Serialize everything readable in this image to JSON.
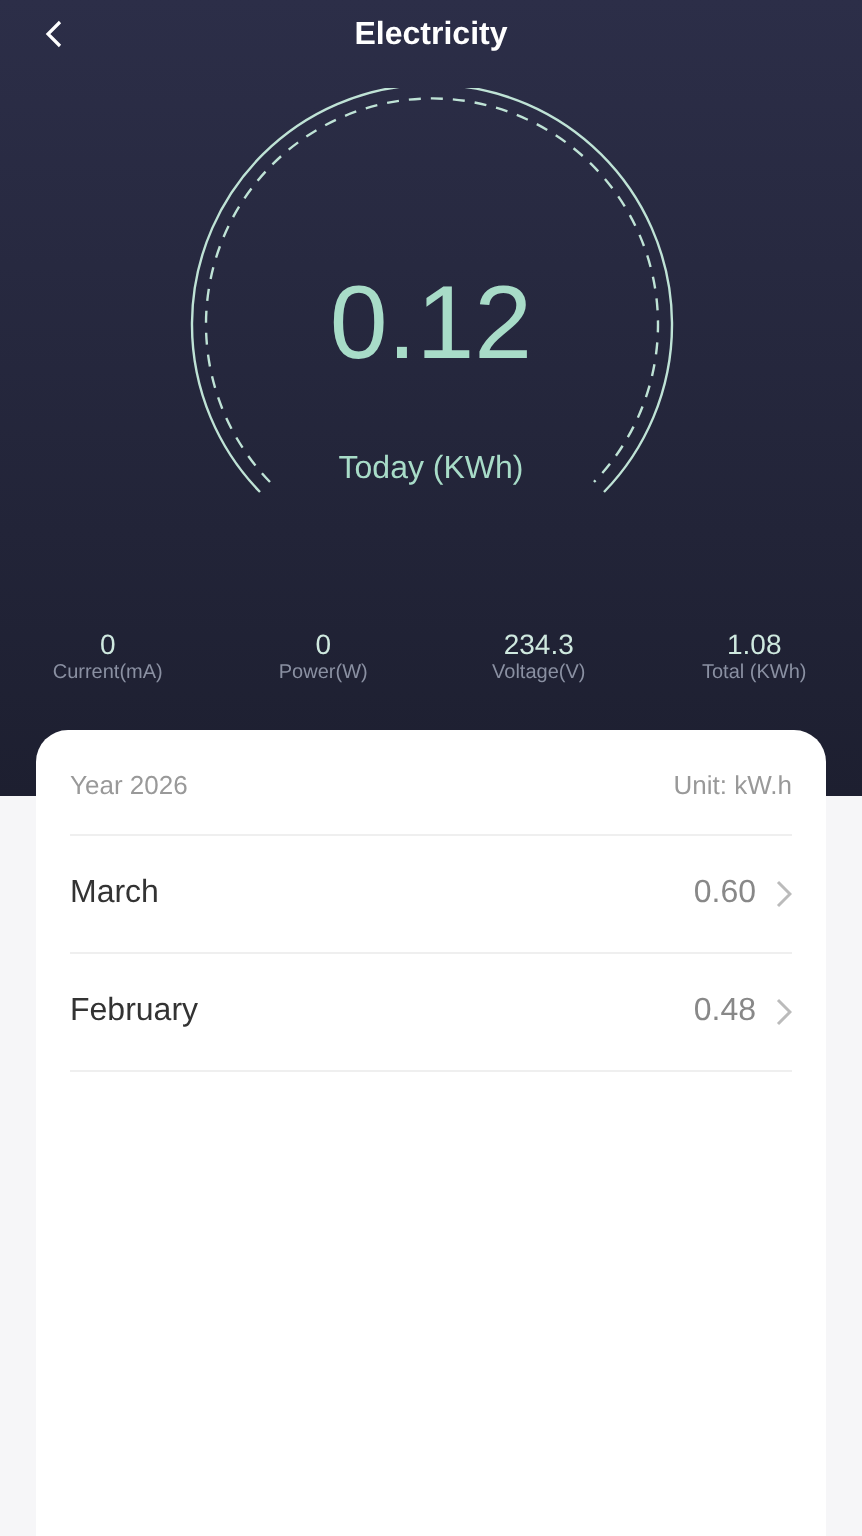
{
  "header": {
    "title": "Electricity"
  },
  "gauge": {
    "value": "0.12",
    "label": "Today (KWh)"
  },
  "stats": [
    {
      "value": "0",
      "label": "Current(mA)"
    },
    {
      "value": "0",
      "label": "Power(W)"
    },
    {
      "value": "234.3",
      "label": "Voltage(V)"
    },
    {
      "value": "1.08",
      "label": "Total (KWh)"
    }
  ],
  "card": {
    "year": "Year 2026",
    "unit": "Unit: kW.h",
    "months": [
      {
        "name": "March",
        "value": "0.60"
      },
      {
        "name": "February",
        "value": "0.48"
      }
    ]
  }
}
